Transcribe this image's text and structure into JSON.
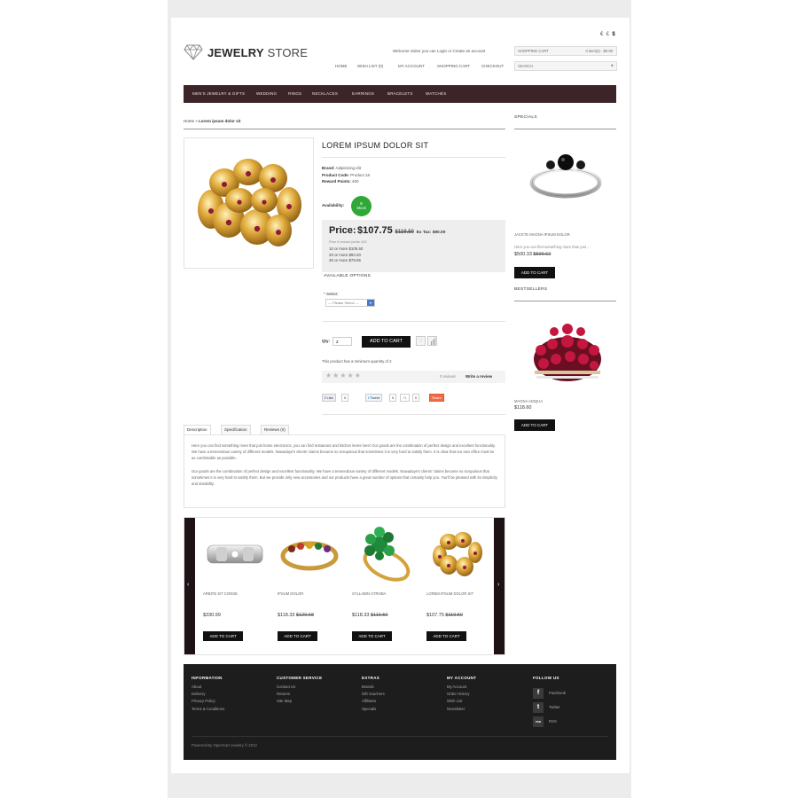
{
  "header": {
    "logo_bold": "JEWELRY",
    "logo_light": "STORE",
    "currency": [
      "€",
      "£",
      "$"
    ],
    "welcome": "Welcome visitor you can Login or Create an account",
    "cart_label": "SHOPPING CART",
    "cart_summary": "0 item(s) - $0.00",
    "search_placeholder": "SEARCH",
    "links": [
      "HOME",
      "WISH LIST (0)",
      "MY ACCOUNT",
      "SHOPPING CART",
      "CHECKOUT"
    ]
  },
  "nav": {
    "items": [
      "MEN'S JEWELRY & GIFTS",
      "WEDDING",
      "RINGS",
      "NECKLACES",
      "EARRINGS",
      "BRACELETS",
      "WATCHES"
    ]
  },
  "breadcrumb": {
    "home": "Home",
    "sep": "»",
    "current": "Lorem ipsum dolor sit"
  },
  "product": {
    "title": "LOREM IPSUM DOLOR SIT",
    "brand_label": "Brand:",
    "brand_value": "Adipisicing elit",
    "code_label": "Product Code:",
    "code_value": "Product 18",
    "points_label": "Reward Points:",
    "points_value": "400",
    "availability_label": "Availability:",
    "availability_value_1": "In",
    "availability_value_2": "Stock",
    "price_label": "Price:",
    "price": "$107.75",
    "old_price": "$119.50",
    "extax": "Ex Tax: $90.00",
    "reward_note": "Price in reward points: 400",
    "discounts": [
      "10 or more $105.60",
      "20 or more $93.40",
      "30 or more $78.55"
    ],
    "options_heading": "AVAILABLE OPTIONS",
    "select_label": "* Select:",
    "select_value": "--- Please Select ---",
    "qty_label": "Qty:",
    "qty_value": "2",
    "add_to_cart": "ADD TO CART",
    "min_note": "This product has a minimum quantity of 2",
    "reviews_count": "0 reviews",
    "write_review": "Write a review",
    "share": {
      "like": "Like",
      "like_count": "0",
      "tweet": "Tweet",
      "tweet_count": "0",
      "gplus": "+1",
      "gplus_count": "0",
      "share_btn": "Share"
    }
  },
  "tabs": [
    "Description",
    "Specification",
    "Reviews (0)"
  ],
  "description": {
    "p1": "Here you can find something more that just home electronics, you can find restaurant and kitchen items here! Our goods are the combination of perfect design and excellent functionality. We have a tremendous variety of different models. Nowadays's clients' claims became so scrupulous that sometimes it is very hard to satisfy them. It is clear that our own office must be as comfortable as possible.",
    "p2": "Our goods are the combination of perfect design and excellent functionality. We have a tremendous variety of different models. Nowadays's clients' claims became so scrupulous that sometimes it is very hard to satisfy them. But we provide only new accessories and our products have a great number of options that certainly help you. You'll be pleased with its simplicity and durability."
  },
  "related": [
    {
      "name": "ARBITE SIT CONSE",
      "price": "$330.99",
      "old": "",
      "button": "ADD TO CART"
    },
    {
      "name": "IPSUM DOLOR",
      "price": "$118.33",
      "old": "$120.68",
      "button": "ADD TO CART"
    },
    {
      "name": "SYLLABIN STROBA",
      "price": "$118.33",
      "old": "$119.50",
      "button": "ADD TO CART"
    },
    {
      "name": "LOREM IPSUM DOLOR SIT",
      "price": "$107.75",
      "old": "$119.50",
      "button": "ADD TO CART"
    }
  ],
  "sidebar": {
    "specials_title": "SPECIALS",
    "special": {
      "name": "JACKTE MAGNA IPSUM DOLOR",
      "desc": "Here you can find something more than just ...",
      "price": "$500.33",
      "old": "$599.62",
      "button": "ADD TO CART"
    },
    "bestsellers_title": "BESTSELLERS",
    "bestseller": {
      "name": "MAGNA ADIQUA",
      "price": "$118.60",
      "button": "ADD TO CART"
    }
  },
  "footer": {
    "cols": [
      {
        "title": "INFORMATION",
        "links": [
          "About",
          "Delivery",
          "Privacy Policy",
          "Terms & Conditions"
        ]
      },
      {
        "title": "CUSTOMER SERVICE",
        "links": [
          "Contact Us",
          "Returns",
          "Site Map"
        ]
      },
      {
        "title": "EXTRAS",
        "links": [
          "Brands",
          "Gift Vouchers",
          "Affiliates",
          "Specials"
        ]
      },
      {
        "title": "MY ACCOUNT",
        "links": [
          "My Account",
          "Order History",
          "Wish List",
          "Newsletter"
        ]
      }
    ],
    "follow_title": "FOLLOW US",
    "social": [
      {
        "icon": "f",
        "label": "Facebook"
      },
      {
        "icon": "t",
        "label": "Twitter"
      },
      {
        "icon": "rss",
        "label": "RSS"
      }
    ],
    "powered": "Powered By OpenCart Jewelry © 2012"
  },
  "colors": {
    "nav_bg": "#3d2428",
    "footer_bg": "#1d1d1d",
    "in_stock": "#2ea836",
    "button": "#111111"
  }
}
